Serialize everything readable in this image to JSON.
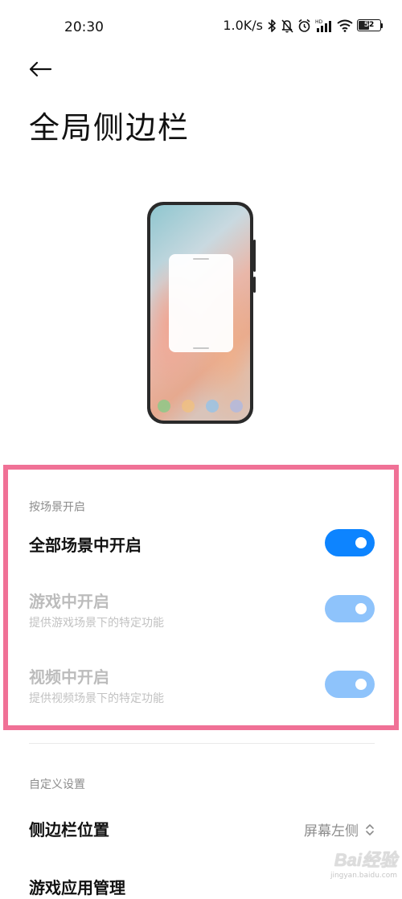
{
  "status_bar": {
    "time": "20:30",
    "net_speed": "1.0K/s",
    "battery_level": "52",
    "icons": [
      "bluetooth-icon",
      "mute-icon",
      "alarm-icon",
      "hd-signal-icon",
      "wifi-icon",
      "battery-icon"
    ]
  },
  "header": {
    "back_icon": "arrow-left-icon",
    "title": "全局侧边栏"
  },
  "scene_section": {
    "label": "按场景开启",
    "items": [
      {
        "title": "全部场景中开启",
        "subtitle": "",
        "enabled": true,
        "toggle_on": true
      },
      {
        "title": "游戏中开启",
        "subtitle": "提供游戏场景下的特定功能",
        "enabled": false,
        "toggle_on": true
      },
      {
        "title": "视频中开启",
        "subtitle": "提供视频场景下的特定功能",
        "enabled": false,
        "toggle_on": true
      }
    ]
  },
  "custom_section": {
    "label": "自定义设置",
    "items": [
      {
        "title": "侧边栏位置",
        "value": "屏幕左侧"
      },
      {
        "title": "游戏应用管理",
        "value": ""
      }
    ]
  },
  "colors": {
    "accent": "#0d84ff",
    "accent_disabled": "#8ec3fb",
    "highlight": "#f07196"
  },
  "watermark": {
    "text": "Bai经验",
    "sub": "jingyan.baidu.com"
  }
}
